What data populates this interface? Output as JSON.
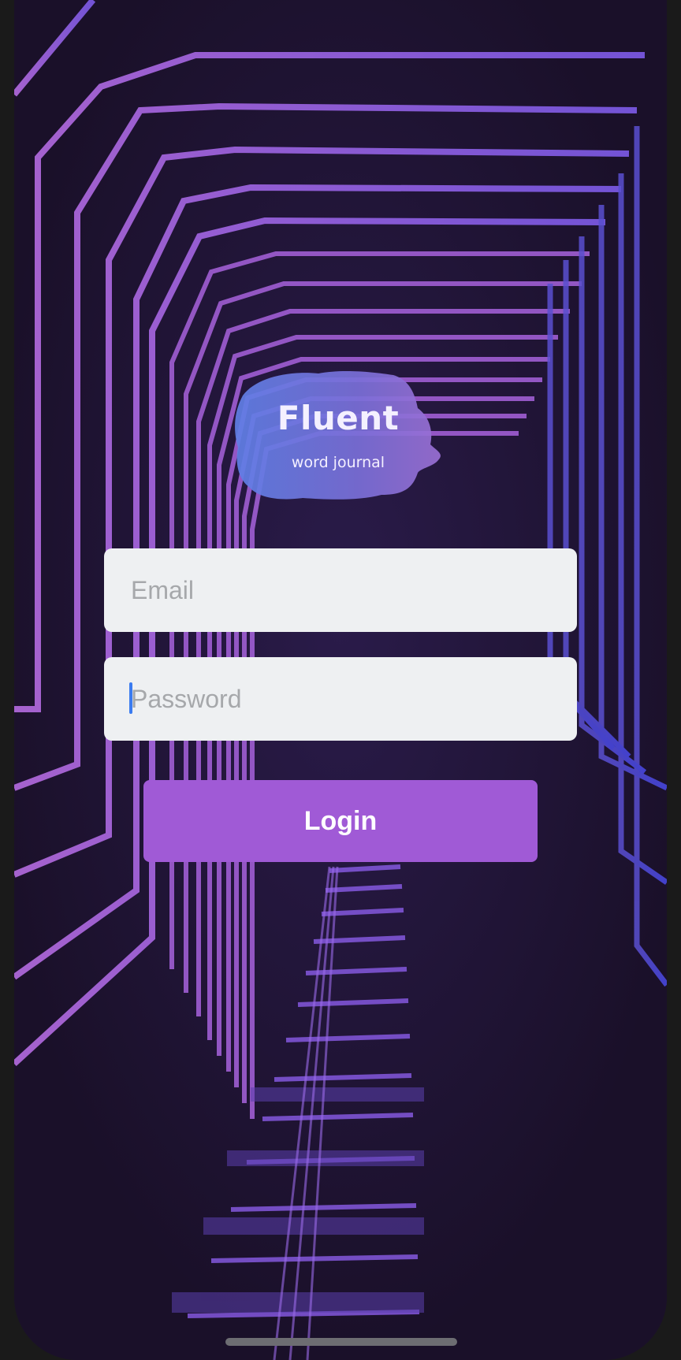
{
  "app": {
    "name": "Fluent",
    "tagline": "word journal"
  },
  "form": {
    "email": {
      "placeholder": "Email",
      "value": ""
    },
    "password": {
      "placeholder": "Password",
      "value": ""
    },
    "login_label": "Login"
  },
  "colors": {
    "background": "#1d1230",
    "accent": "#a05ad6",
    "field_bg": "#eef0f2",
    "neon_purple": "#b56be0",
    "neon_blue": "#6a5cf0",
    "caret": "#3a7bf0"
  },
  "icons": {
    "logo": "watercolor-brush-stroke"
  }
}
